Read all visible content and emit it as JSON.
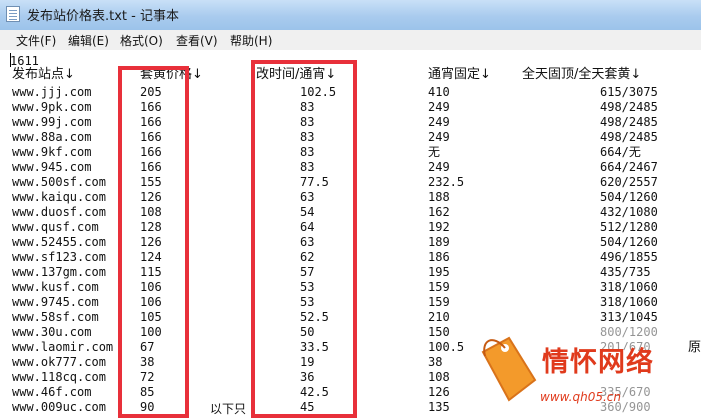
{
  "window": {
    "title": "发布站价格表.txt - 记事本"
  },
  "menu": [
    "文件(F)",
    "编辑(E)",
    "格式(O)",
    "查看(V)",
    "帮助(H)"
  ],
  "editor": {
    "first_line": "1611",
    "headers": {
      "site": "发布站点↓",
      "package": "套黄价格↓",
      "time": "改时间/通宵↓",
      "fixed": "通宵固定↓",
      "day": "全天固顶/全天套黄↓"
    },
    "rows": [
      {
        "site": "www.jjj.com",
        "package": "205",
        "time": "102.5",
        "fixed": "410",
        "day": "615/3075"
      },
      {
        "site": "www.9pk.com",
        "package": "166",
        "time": "83",
        "fixed": "249",
        "day": "498/2485"
      },
      {
        "site": "www.99j.com",
        "package": "166",
        "time": "83",
        "fixed": "249",
        "day": "498/2485"
      },
      {
        "site": "www.88a.com",
        "package": "166",
        "time": "83",
        "fixed": "249",
        "day": "498/2485"
      },
      {
        "site": "www.9kf.com",
        "package": "166",
        "time": "83",
        "fixed": "无",
        "day": "664/无"
      },
      {
        "site": "www.945.com",
        "package": "166",
        "time": "83",
        "fixed": "249",
        "day": "664/2467"
      },
      {
        "site": "www.500sf.com",
        "package": "155",
        "time": "77.5",
        "fixed": "232.5",
        "day": "620/2557"
      },
      {
        "site": "www.kaiqu.com",
        "package": "126",
        "time": "63",
        "fixed": "188",
        "day": "504/1260"
      },
      {
        "site": "www.duosf.com",
        "package": "108",
        "time": "54",
        "fixed": "162",
        "day": "432/1080"
      },
      {
        "site": "www.qusf.com",
        "package": "128",
        "time": "64",
        "fixed": "192",
        "day": "512/1280"
      },
      {
        "site": "www.52455.com",
        "package": "126",
        "time": "63",
        "fixed": "189",
        "day": "504/1260"
      },
      {
        "site": "www.sf123.com",
        "package": "124",
        "time": "62",
        "fixed": "186",
        "day": "496/1855"
      },
      {
        "site": "www.137gm.com",
        "package": "115",
        "time": "57",
        "fixed": "195",
        "day": "435/735"
      },
      {
        "site": "www.kusf.com",
        "package": "106",
        "time": "53",
        "fixed": "159",
        "day": "318/1060"
      },
      {
        "site": "www.9745.com",
        "package": "106",
        "time": "53",
        "fixed": "159",
        "day": "318/1060"
      },
      {
        "site": "www.58sf.com",
        "package": "105",
        "time": "52.5",
        "fixed": "210",
        "day": "313/1045"
      },
      {
        "site": "www.30u.com",
        "package": "100",
        "time": "50",
        "fixed": "150",
        "day": "800/1200"
      },
      {
        "site": "www.laomir.com",
        "package": "67",
        "time": "33.5",
        "fixed": "100.5",
        "day": "201/670"
      },
      {
        "site": "www.ok777.com",
        "package": "38",
        "time": "19",
        "fixed": "38",
        "day": ""
      },
      {
        "site": "www.118cq.com",
        "package": "72",
        "time": "36",
        "fixed": "108",
        "day": ""
      },
      {
        "site": "www.46f.com",
        "package": "85",
        "time": "42.5",
        "fixed": "126",
        "day": "335/670"
      },
      {
        "site": "www.009uc.com",
        "package": "90",
        "time": "45",
        "fixed": "135",
        "day": "360/900"
      }
    ],
    "partial_bottom_text": "以下只",
    "partial_right_char": "原"
  },
  "watermark": {
    "title": "情怀网络",
    "subtitle": "www.qh05.cn"
  },
  "colors": {
    "highlight": "#e8303a",
    "titlebar": "#a9cbee",
    "watermark": "#e03a1c"
  }
}
